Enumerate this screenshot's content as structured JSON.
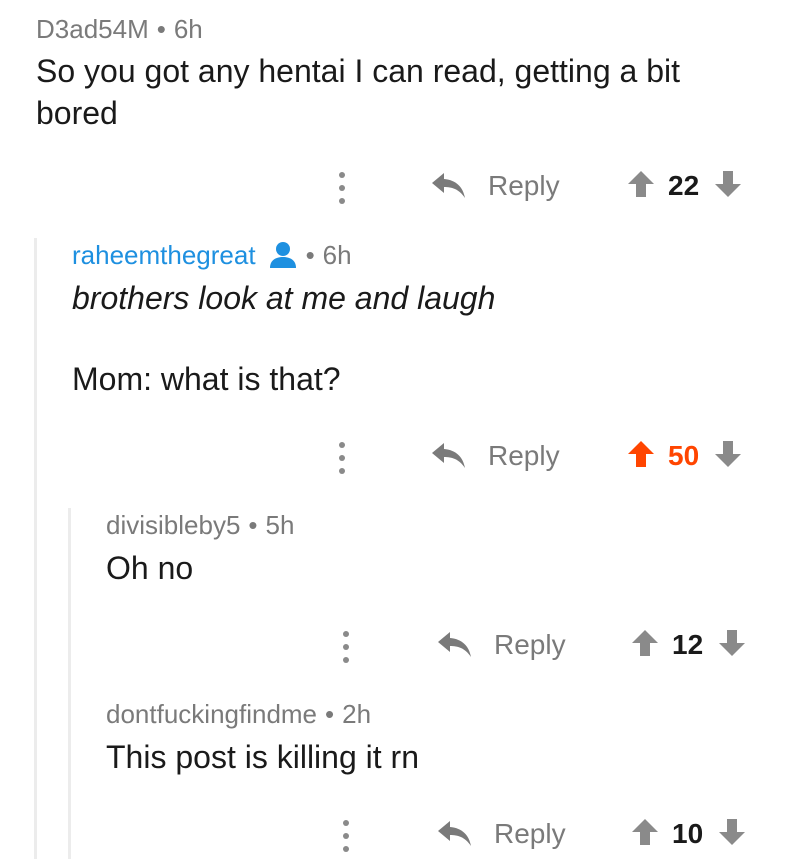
{
  "colors": {
    "upvoted": "#ff4500",
    "username_highlight": "#1e90e0",
    "meta_text": "#7a7a7a",
    "arrow_neutral": "#8a8a8a"
  },
  "comments": [
    {
      "username": "D3ad54M",
      "time": "6h",
      "text_lines": [
        "So you got any hentai I can read, getting a bit",
        "bored"
      ],
      "reply_label": "Reply",
      "score": "22",
      "upvoted": false
    },
    {
      "username": "raheemthegreat",
      "user_icon": "person-icon",
      "time": "6h",
      "text_line1": "brothers look at me and laugh",
      "text_line2": "Mom: what is that?",
      "reply_label": "Reply",
      "score": "50",
      "upvoted": true
    },
    {
      "username": "divisibleby5",
      "time": "5h",
      "text": "Oh no",
      "reply_label": "Reply",
      "score": "12",
      "upvoted": false
    },
    {
      "username": "dontfuckingfindme",
      "time": "2h",
      "text": "This post is killing it rn",
      "reply_label": "Reply",
      "score": "10",
      "upvoted": false
    }
  ]
}
